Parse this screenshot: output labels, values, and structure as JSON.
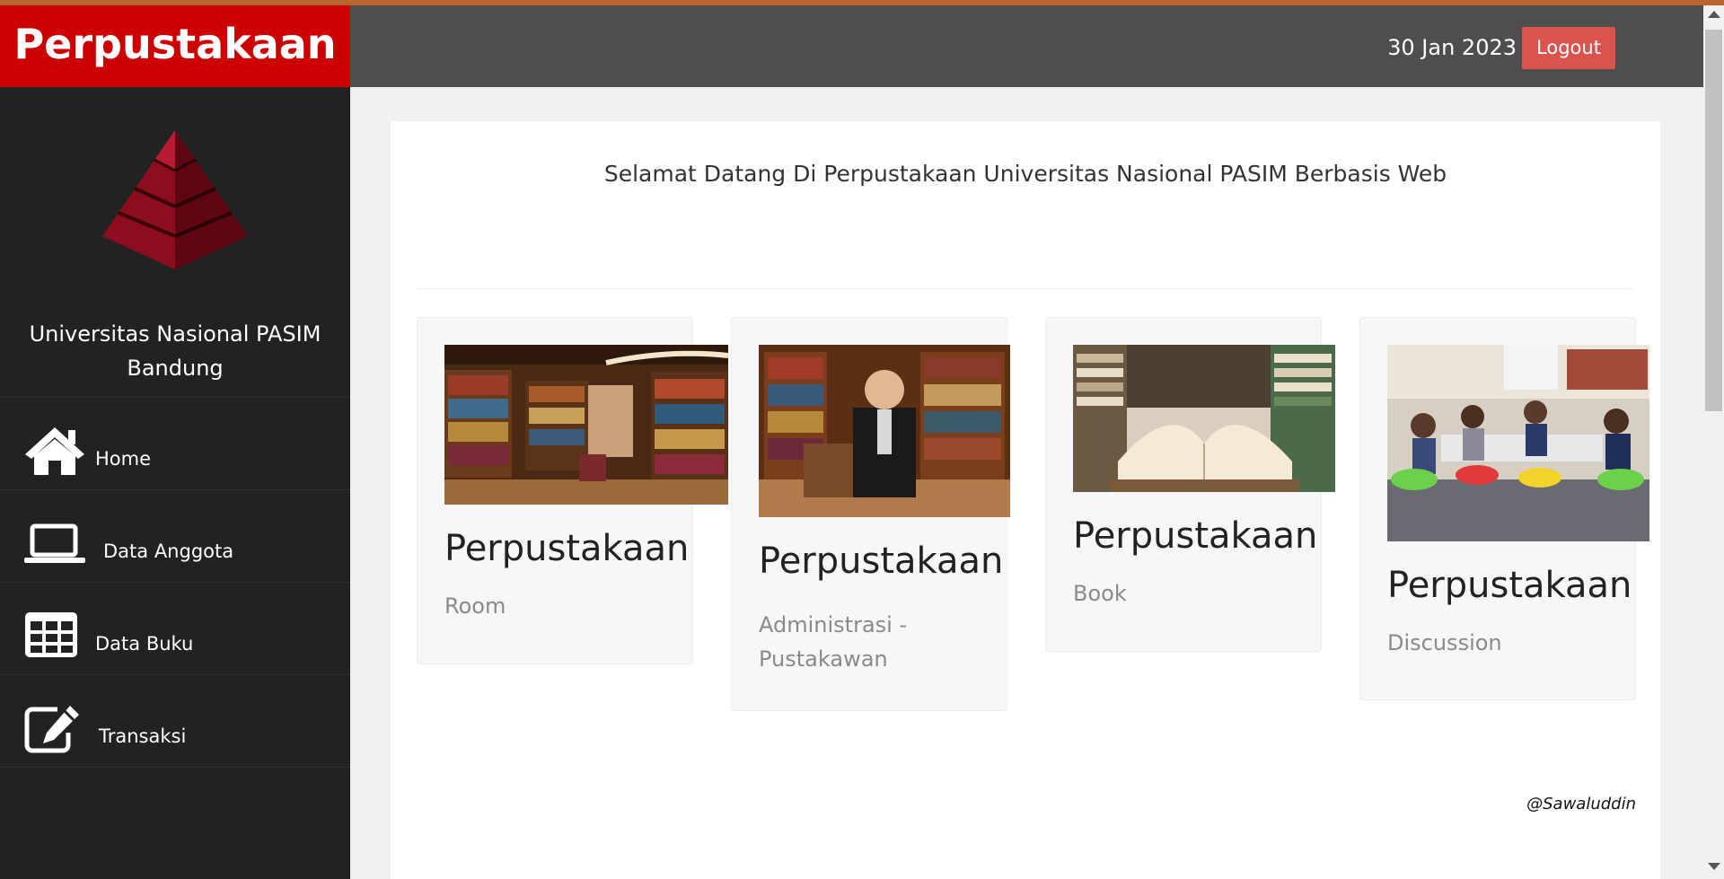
{
  "app": {
    "brand": "Perpustakaan",
    "date": "30 Jan 2023",
    "logout_label": "Logout",
    "university": "Universitas Nasional PASIM Bandung"
  },
  "colors": {
    "brand_red": "#cc0000",
    "topbar": "#4e4e4e",
    "sidebar": "#222222",
    "logout": "#d9534f"
  },
  "nav": [
    {
      "label": "Home",
      "icon": "home-icon"
    },
    {
      "label": "Data Anggota",
      "icon": "laptop-icon"
    },
    {
      "label": "Data Buku",
      "icon": "table-icon"
    },
    {
      "label": "Transaksi",
      "icon": "edit-icon"
    }
  ],
  "main": {
    "welcome": "Selamat Datang Di Perpustakaan Universitas Nasional PASIM Berbasis Web",
    "cards": [
      {
        "title": "Perpustakaan",
        "subtitle": "Room",
        "image": "library-room-photo"
      },
      {
        "title": "Perpustakaan",
        "subtitle": "Administrasi - Pustakawan",
        "image": "librarian-photo"
      },
      {
        "title": "Perpustakaan",
        "subtitle": "Book",
        "image": "open-book-photo"
      },
      {
        "title": "Perpustakaan",
        "subtitle": "Discussion",
        "image": "discussion-photo"
      }
    ],
    "credit": "@Sawaluddin"
  }
}
